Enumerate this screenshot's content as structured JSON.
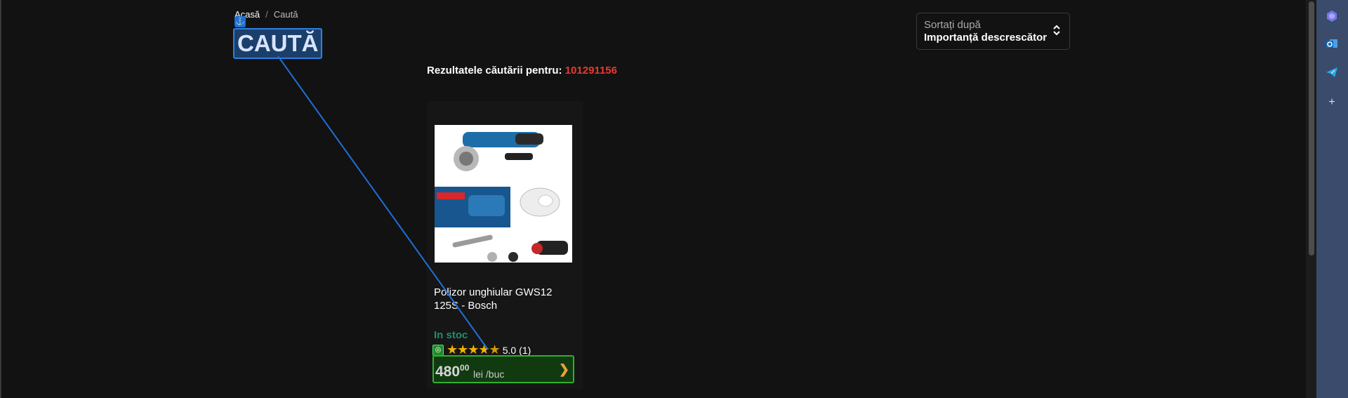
{
  "breadcrumb": {
    "home": "Acasă",
    "separator": "/",
    "current": "Caută"
  },
  "page_title": "CAUTĂ",
  "anchor_icon": "anchor-icon",
  "sort": {
    "label": "Sortați după",
    "value": "Importanță descrescător",
    "icon": "chevron-updown-icon"
  },
  "results": {
    "prefix": "Rezultatele căutării pentru:",
    "query": "101291156"
  },
  "product": {
    "name": "Polizor unghiular GWS12 125S - Bosch",
    "stock": "In stoc",
    "rating_icon": "promo-icon",
    "stars": 4.5,
    "rating_value": "5.0",
    "rating_count": "(1)",
    "price_whole": "480",
    "price_cents": "00",
    "price_unit": "lei /buc",
    "arrow": "❯"
  },
  "side_panel": {
    "icons": [
      "copilot-icon",
      "outlook-icon",
      "telegram-icon",
      "add-icon"
    ],
    "add_glyph": "+"
  },
  "colors": {
    "background": "#121212",
    "accent_red": "#e8392f",
    "stock_green": "#1f8f6a",
    "price_border": "#2fb02f",
    "highlight_blue": "#2f7fe0"
  }
}
